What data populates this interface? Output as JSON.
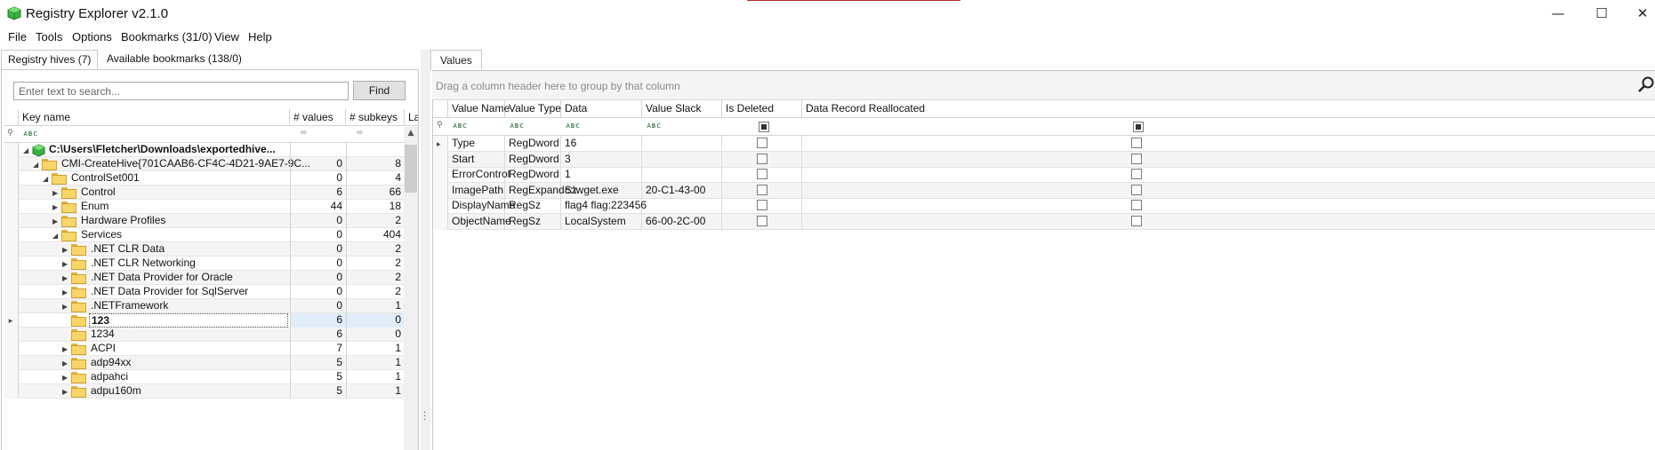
{
  "app": {
    "title": "Registry Explorer v2.1.0"
  },
  "window_controls": {
    "minimize": "—",
    "maximize": "☐",
    "close": "✕"
  },
  "menu": [
    "File",
    "Tools",
    "Options",
    "Bookmarks (31/0)",
    "View",
    "Help"
  ],
  "left_tabs": [
    "Registry hives (7)",
    "Available bookmarks (138/0)"
  ],
  "search": {
    "placeholder": "Enter text to search...",
    "button": "Find"
  },
  "tree": {
    "columns": [
      "Key name",
      "# values",
      "# subkeys",
      "La"
    ],
    "filter_value_icon": "abc-filter-icon",
    "rows": [
      {
        "name": "C:\\Users\\Fletcher\\Downloads\\exportedhive...",
        "values": "",
        "subkeys": "",
        "bold": true
      },
      {
        "name": "CMI-CreateHive{701CAAB6-CF4C-4D21-9AE7-9C...",
        "values": "0",
        "subkeys": "8"
      },
      {
        "name": "ControlSet001",
        "values": "0",
        "subkeys": "4"
      },
      {
        "name": "Control",
        "values": "6",
        "subkeys": "66"
      },
      {
        "name": "Enum",
        "values": "44",
        "subkeys": "18"
      },
      {
        "name": "Hardware Profiles",
        "values": "0",
        "subkeys": "2"
      },
      {
        "name": "Services",
        "values": "0",
        "subkeys": "404"
      },
      {
        "name": ".NET CLR Data",
        "values": "0",
        "subkeys": "2"
      },
      {
        "name": ".NET CLR Networking",
        "values": "0",
        "subkeys": "2"
      },
      {
        "name": ".NET Data Provider for Oracle",
        "values": "0",
        "subkeys": "2"
      },
      {
        "name": ".NET Data Provider for SqlServer",
        "values": "0",
        "subkeys": "2"
      },
      {
        "name": ".NETFramework",
        "values": "0",
        "subkeys": "1"
      },
      {
        "name": "123",
        "values": "6",
        "subkeys": "0",
        "selected": true
      },
      {
        "name": "1234",
        "values": "6",
        "subkeys": "0"
      },
      {
        "name": "ACPI",
        "values": "7",
        "subkeys": "1"
      },
      {
        "name": "adp94xx",
        "values": "5",
        "subkeys": "1"
      },
      {
        "name": "adpahci",
        "values": "5",
        "subkeys": "1"
      },
      {
        "name": "adpu160m",
        "values": "5",
        "subkeys": "1"
      }
    ]
  },
  "right_tab": "Values",
  "values_panel": {
    "group_hint": "Drag a column header here to group by that column",
    "columns": [
      "Value Name",
      "Value Type",
      "Data",
      "Value Slack",
      "Is Deleted",
      "Data Record Reallocated"
    ],
    "rows": [
      {
        "name": "Type",
        "type": "RegDword",
        "data": "16",
        "slack": ""
      },
      {
        "name": "Start",
        "type": "RegDword",
        "data": "3",
        "slack": ""
      },
      {
        "name": "ErrorControl",
        "type": "RegDword",
        "data": "1",
        "slack": ""
      },
      {
        "name": "ImagePath",
        "type": "RegExpandSz",
        "data": "c:\\wget.exe",
        "slack": "20-C1-43-00"
      },
      {
        "name": "DisplayName",
        "type": "RegSz",
        "data": "flag4 flag:223456",
        "slack": ""
      },
      {
        "name": "ObjectName",
        "type": "RegSz",
        "data": "LocalSystem",
        "slack": "66-00-2C-00"
      }
    ]
  },
  "filter_glyph": "ᴀʙc",
  "equals_glyph": "=",
  "colors": {
    "folder": "#f7d568",
    "hive_icon": "#3cb043",
    "selection": "#e0ecf8"
  }
}
